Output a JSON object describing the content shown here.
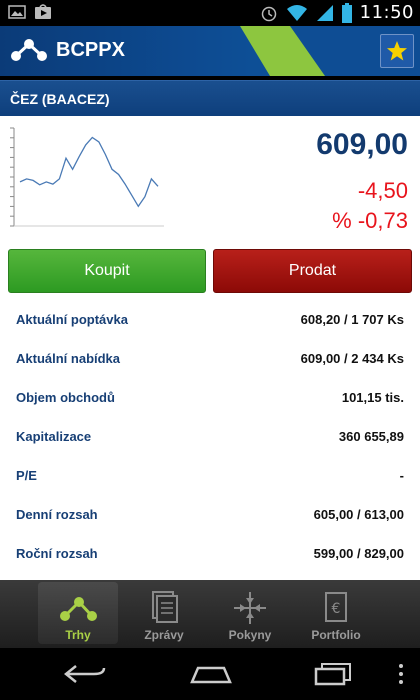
{
  "status_bar": {
    "time": "11:50",
    "icons": [
      "image-icon",
      "play-store-icon",
      "alarm-icon",
      "wifi-icon",
      "signal-icon",
      "battery-icon"
    ]
  },
  "app": {
    "title": "BCPPX",
    "logo": "share-network-icon",
    "favorite": "star-icon"
  },
  "stock": {
    "name": "ČEZ (BAACEZ)",
    "price": "609,00",
    "change": "-4,50",
    "change_pct": "% -0,73"
  },
  "actions": {
    "buy_label": "Koupit",
    "sell_label": "Prodat"
  },
  "details": [
    {
      "label": "Aktuální poptávka",
      "value": "608,20 / 1 707 Ks"
    },
    {
      "label": "Aktuální nabídka",
      "value": "609,00 / 2 434 Ks"
    },
    {
      "label": "Objem obchodů",
      "value": "101,15 tis."
    },
    {
      "label": "Kapitalizace",
      "value": "360 655,89"
    },
    {
      "label": "P/E",
      "value": "-"
    },
    {
      "label": "Denní rozsah",
      "value": "605,00 / 613,00"
    },
    {
      "label": "Roční rozsah",
      "value": "599,00 / 829,00"
    }
  ],
  "tabs": [
    {
      "label": "Trhy",
      "icon": "share-network-icon",
      "active": true
    },
    {
      "label": "Zprávy",
      "icon": "documents-icon",
      "active": false
    },
    {
      "label": "Pokyny",
      "icon": "arrows-in-icon",
      "active": false
    },
    {
      "label": "Portfolio",
      "icon": "euro-card-icon",
      "active": false
    }
  ],
  "colors": {
    "brand": "#0d4a90",
    "accent_green": "#8dc63f",
    "negative": "#e8141c",
    "price": "#133a6e"
  },
  "chart_data": {
    "type": "line",
    "title": "",
    "xlabel": "",
    "ylabel": "",
    "y": [
      0.62,
      0.58,
      0.6,
      0.66,
      0.62,
      0.65,
      0.58,
      0.3,
      0.45,
      0.28,
      0.12,
      0.02,
      0.08,
      0.25,
      0.45,
      0.52,
      0.65,
      0.8,
      0.95,
      0.82,
      0.58,
      0.68
    ],
    "grid": false
  }
}
